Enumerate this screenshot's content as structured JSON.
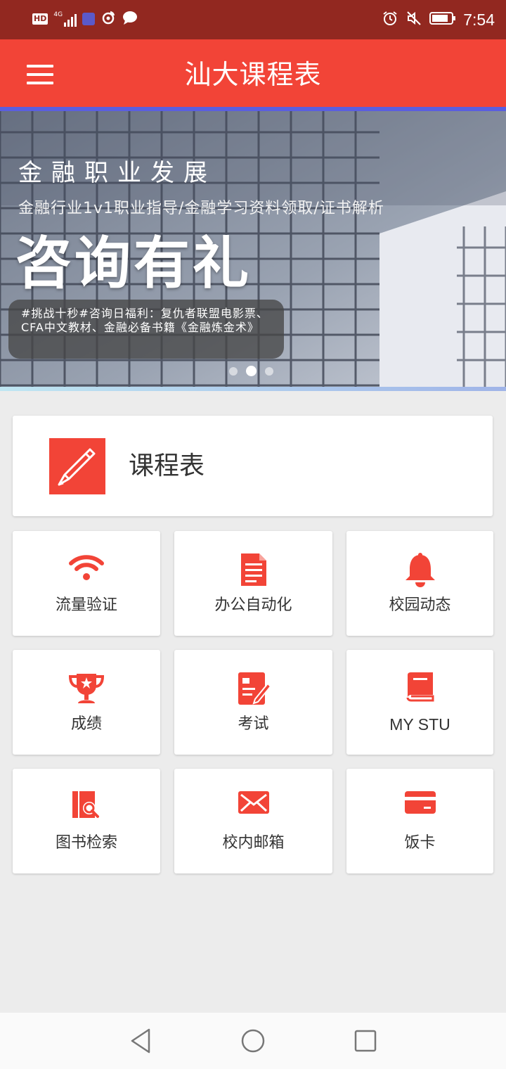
{
  "status_bar": {
    "network": "HD",
    "signal": "4G",
    "time": "7:54"
  },
  "app_bar": {
    "title": "汕大课程表",
    "menu_icon": "hamburger-menu-icon"
  },
  "banner": {
    "heading": "金融职业发展",
    "subheading": "金融行业1v1职业指导/金融学习资料领取/证书解析",
    "headline": "咨询有礼",
    "bubble_text": "#挑战十秒#咨询日福利：复仇者联盟电影票、CFA中文教材、金融必备书籍《金融炼金术》",
    "active_slide": 2,
    "slide_count": 3
  },
  "schedule": {
    "label": "课程表",
    "icon": "pencil-icon"
  },
  "tiles": [
    {
      "label": "流量验证",
      "icon": "wifi-icon"
    },
    {
      "label": "办公自动化",
      "icon": "document-icon"
    },
    {
      "label": "校园动态",
      "icon": "bell-icon"
    },
    {
      "label": "成绩",
      "icon": "trophy-icon"
    },
    {
      "label": "考试",
      "icon": "exam-icon"
    },
    {
      "label": "MY STU",
      "icon": "book-icon"
    },
    {
      "label": "图书检索",
      "icon": "book-search-icon"
    },
    {
      "label": "校内邮箱",
      "icon": "mail-icon"
    },
    {
      "label": "饭卡",
      "icon": "card-icon"
    }
  ],
  "colors": {
    "primary": "#f24437",
    "status_bar": "#922820",
    "background": "#ececec"
  }
}
